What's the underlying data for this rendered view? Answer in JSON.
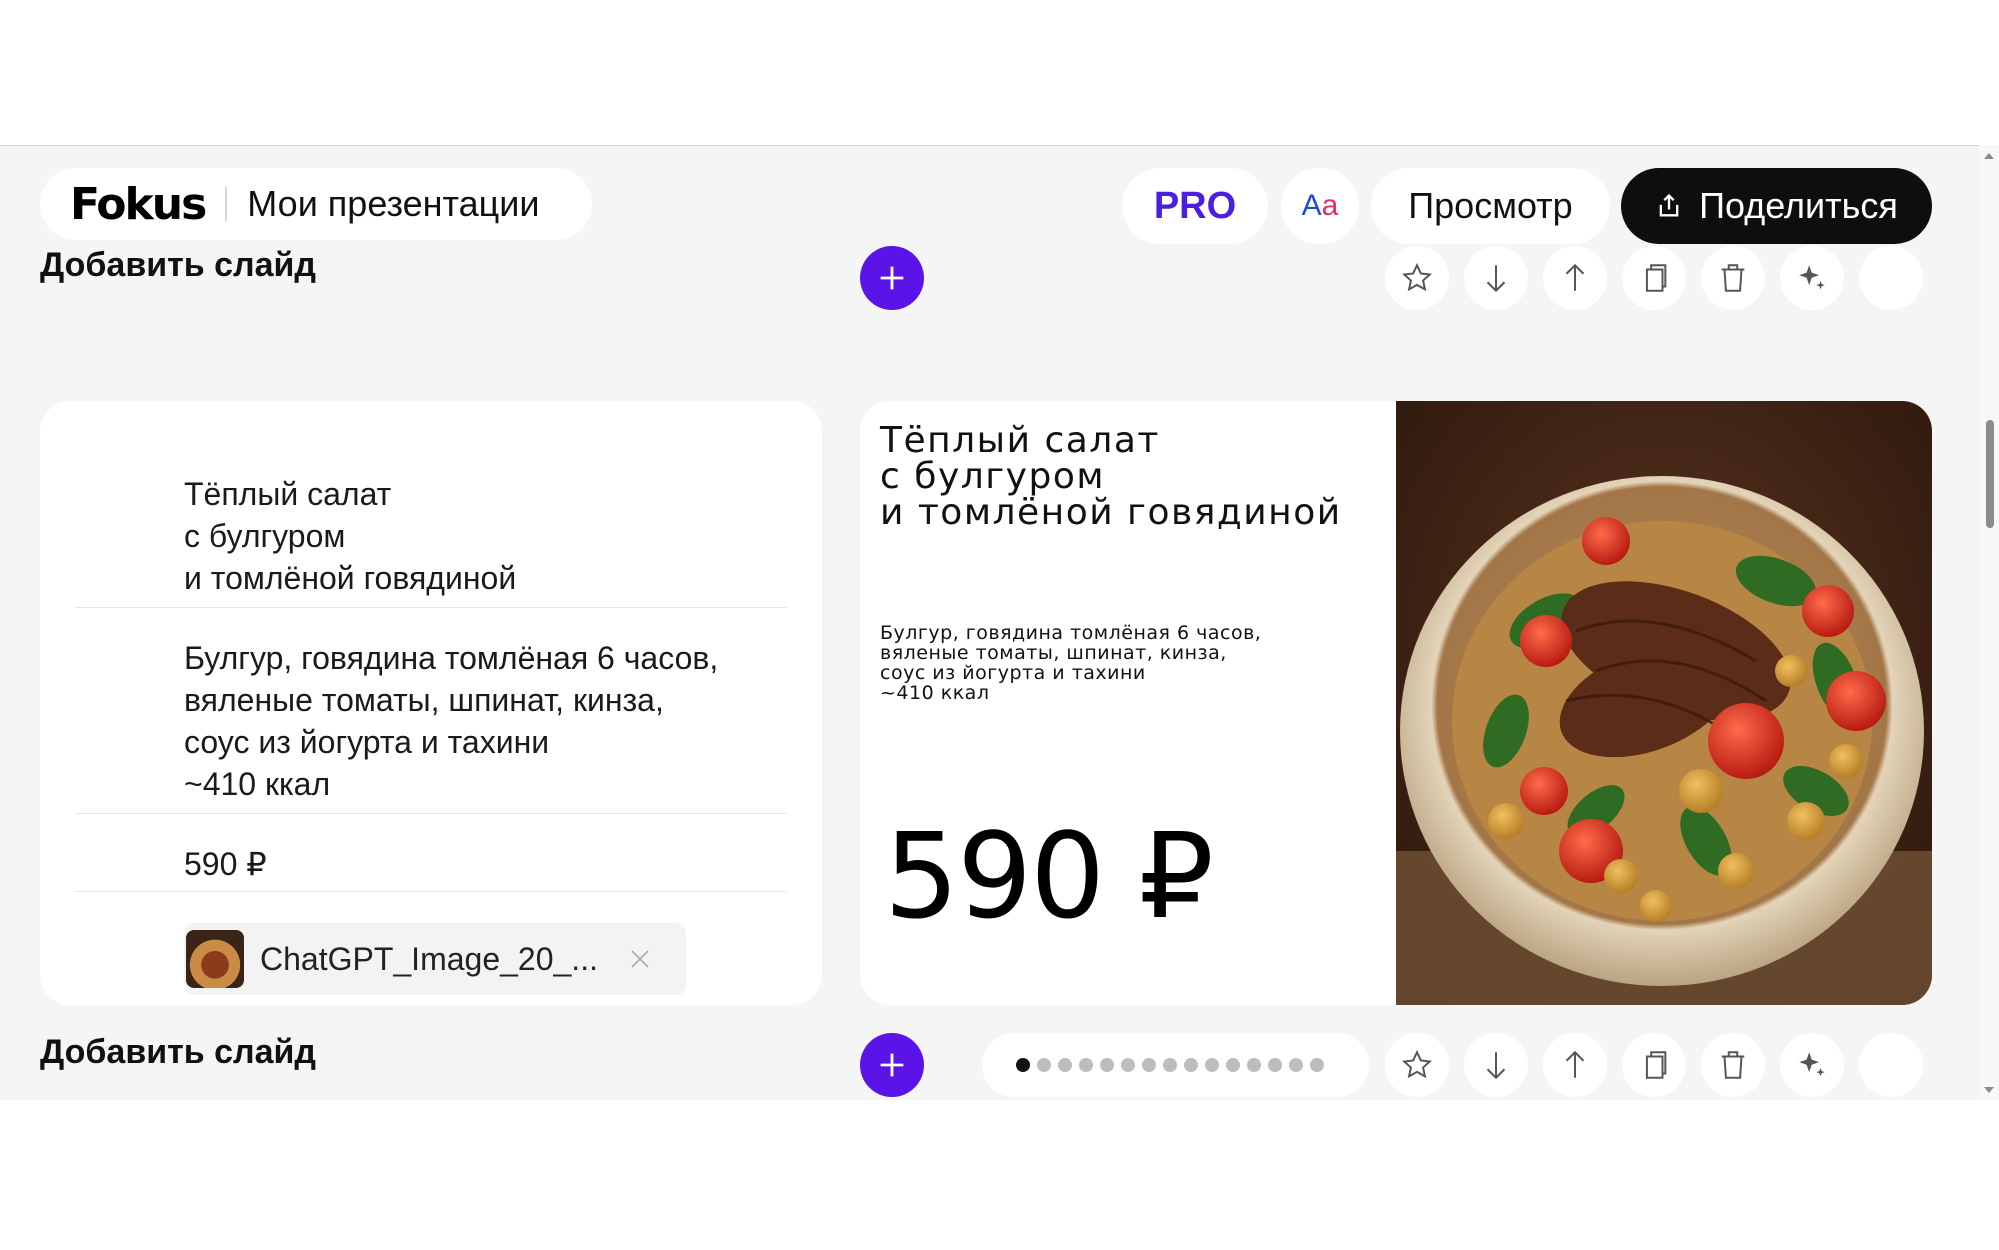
{
  "header": {
    "logo": "Fokus",
    "my_presentations": "Мои презентации",
    "pro": "PRO",
    "font_a1": "A",
    "font_a2": "a",
    "preview": "Просмотр",
    "share": "Поделиться"
  },
  "add_slide_label": "Добавить слайд",
  "editor": {
    "title_lines": [
      "Тёплый салат",
      "с булгуром",
      "и томлёной говядиной"
    ],
    "description_lines": [
      "Булгур, говядина томлёная 6 часов,",
      "вяленые томаты, шпинат, кинза,",
      "соус из йогурта и тахини",
      "~410 ккал"
    ],
    "price": "590 ₽",
    "attachment_name": "ChatGPT_Image_20_..."
  },
  "slide": {
    "title_lines": [
      "Тёплый салат",
      "с булгуром",
      "и томлёной говядиной"
    ],
    "description_lines": [
      "Булгур, говядина томлёная 6 часов,",
      "вяленые томаты, шпинат, кинза,",
      "соус из йогурта и тахини",
      "~410 ккал"
    ],
    "price": "590 ₽"
  },
  "pagination": {
    "total": 15,
    "active_index": 0
  },
  "toolbar_icons": [
    "star-icon",
    "arrow-down-icon",
    "arrow-up-icon",
    "copy-icon",
    "trash-icon",
    "sparkle-icon",
    "more-icon"
  ],
  "colors": {
    "accent": "#5b14e8",
    "pro": "#4b1ee0",
    "share_bg": "#0e0e0e"
  }
}
